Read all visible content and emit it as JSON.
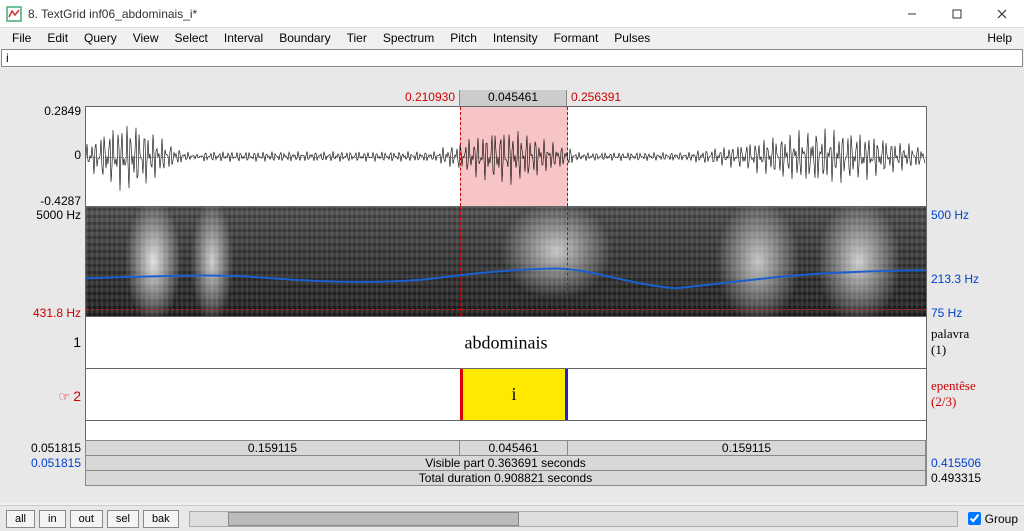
{
  "window": {
    "title": "8. TextGrid inf06_abdominais_i*"
  },
  "menu": {
    "items": [
      "File",
      "Edit",
      "Query",
      "View",
      "Select",
      "Interval",
      "Boundary",
      "Tier",
      "Spectrum",
      "Pitch",
      "Intensity",
      "Formant",
      "Pulses"
    ],
    "help": "Help"
  },
  "entry": {
    "value": "i"
  },
  "topnum": {
    "pre": "0.210930",
    "sel": "0.045461",
    "post": "0.256391"
  },
  "waveaxis": {
    "ymax": "0.2849",
    "yzero": "0",
    "ymin": "-0.4287"
  },
  "specaxis": {
    "left_top": "5000 Hz",
    "left_bot": "431.8 Hz",
    "right_top": "500 Hz",
    "right_mid": "213.3 Hz",
    "right_bot": "75 Hz"
  },
  "tiers": {
    "t1": {
      "num": "1",
      "text": "abdominais",
      "label": "palavra",
      "count": "(1)"
    },
    "t2": {
      "num": "2",
      "text": "i",
      "label": "epentêse",
      "count": "(2/3)"
    }
  },
  "selbar": {
    "pre": "0.159115",
    "sel": "0.045461",
    "post": "0.159115"
  },
  "visbar": "Visible part 0.363691 seconds",
  "totbar": "Total duration 0.908821 seconds",
  "cornerL": {
    "top": "0.051815",
    "mid": "0.051815"
  },
  "cornerR": {
    "top": "0.415506",
    "mid": "0.493315"
  },
  "buttons": {
    "all": "all",
    "in": "in",
    "out": "out",
    "sel": "sel",
    "bak": "bak"
  },
  "group": "Group",
  "chart_data": {
    "type": "line",
    "title": "Waveform + Spectrogram + Pitch (abdominais)",
    "waveform": {
      "ylim": [
        -0.4287,
        0.2849
      ],
      "selection_s": [
        0.21093,
        0.256391
      ]
    },
    "spectrogram": {
      "freq_range_hz": [
        0,
        5000
      ]
    },
    "pitch": {
      "range_hz": [
        75,
        500
      ],
      "approximate_mean_hz": 213.3,
      "floor_hz_at_cursor": 431.8
    },
    "time": {
      "visible_s": 0.363691,
      "total_s": 0.908821,
      "window_start_s": 0.051815,
      "window_end_s": 0.415506
    },
    "textgrid": {
      "tier1_palavra": [
        {
          "label": "abdominais",
          "xmin": 0.051815,
          "xmax": 0.415506
        }
      ],
      "tier2_epentese": [
        {
          "label": "i",
          "xmin": 0.21093,
          "xmax": 0.256391
        }
      ]
    }
  }
}
